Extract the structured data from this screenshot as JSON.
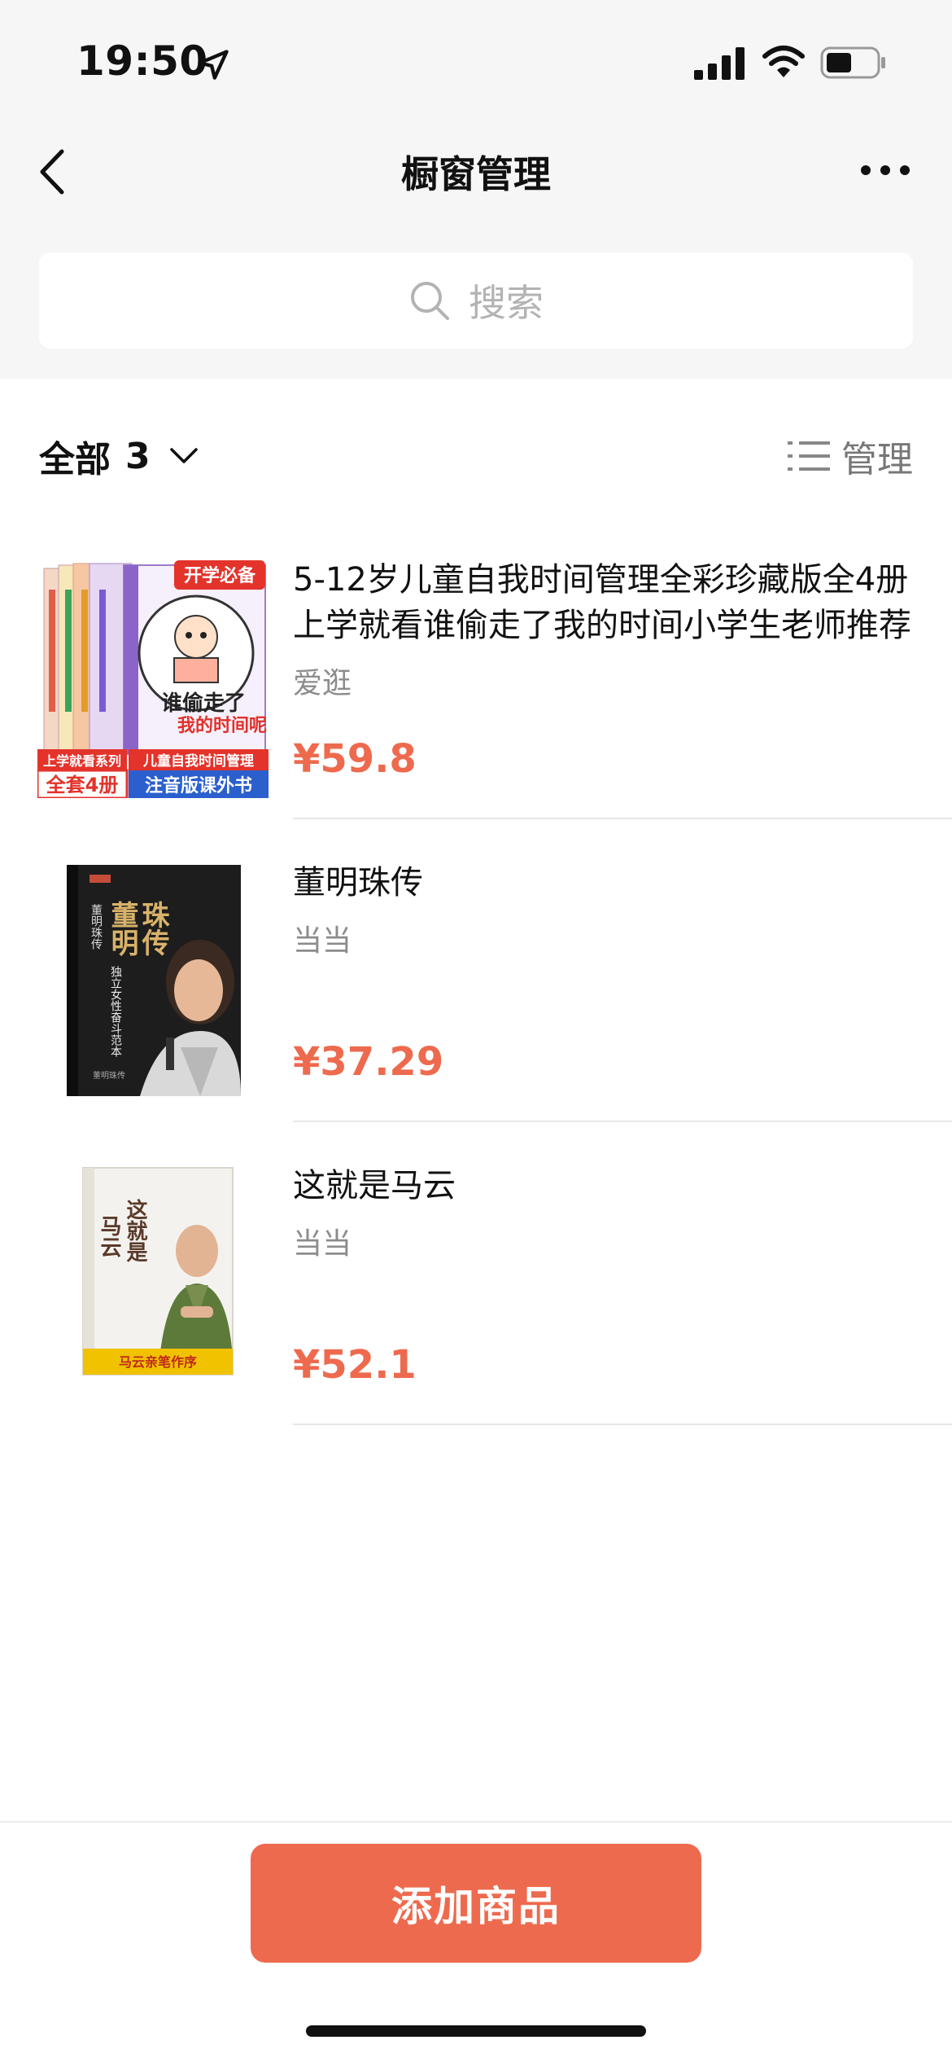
{
  "status_bar": {
    "time": "19:50"
  },
  "nav": {
    "title": "橱窗管理"
  },
  "search": {
    "placeholder": "搜索"
  },
  "filter": {
    "label": "全部",
    "count": "3",
    "manage_label": "管理"
  },
  "products": [
    {
      "title": "5-12岁儿童自我时间管理全彩珍藏版全4册上学就看谁偷走了我的时间小学生老师推荐",
      "seller": "爱逛",
      "price": "¥59.8",
      "cover_text": {
        "badge": "开学必备",
        "main": "谁偷走了我的时间呢",
        "bottom_left_1": "上学就看系列",
        "bottom_left_2": "全套4册",
        "bottom_right_1": "儿童自我时间管理",
        "bottom_right_2": "注音版课外书"
      }
    },
    {
      "title": "董明珠传",
      "seller": "当当",
      "price": "¥37.29",
      "cover_text": {
        "main": "董明珠传",
        "sub": "独立女性奋斗范本"
      }
    },
    {
      "title": "这就是马云",
      "seller": "当当",
      "price": "¥52.1",
      "cover_text": {
        "main": "这就是马云",
        "band": "马云亲笔作序"
      }
    }
  ],
  "bottom": {
    "add_button": "添加商品"
  },
  "colors": {
    "accent": "#ee6a4e",
    "background_top": "#f6f6f6"
  }
}
